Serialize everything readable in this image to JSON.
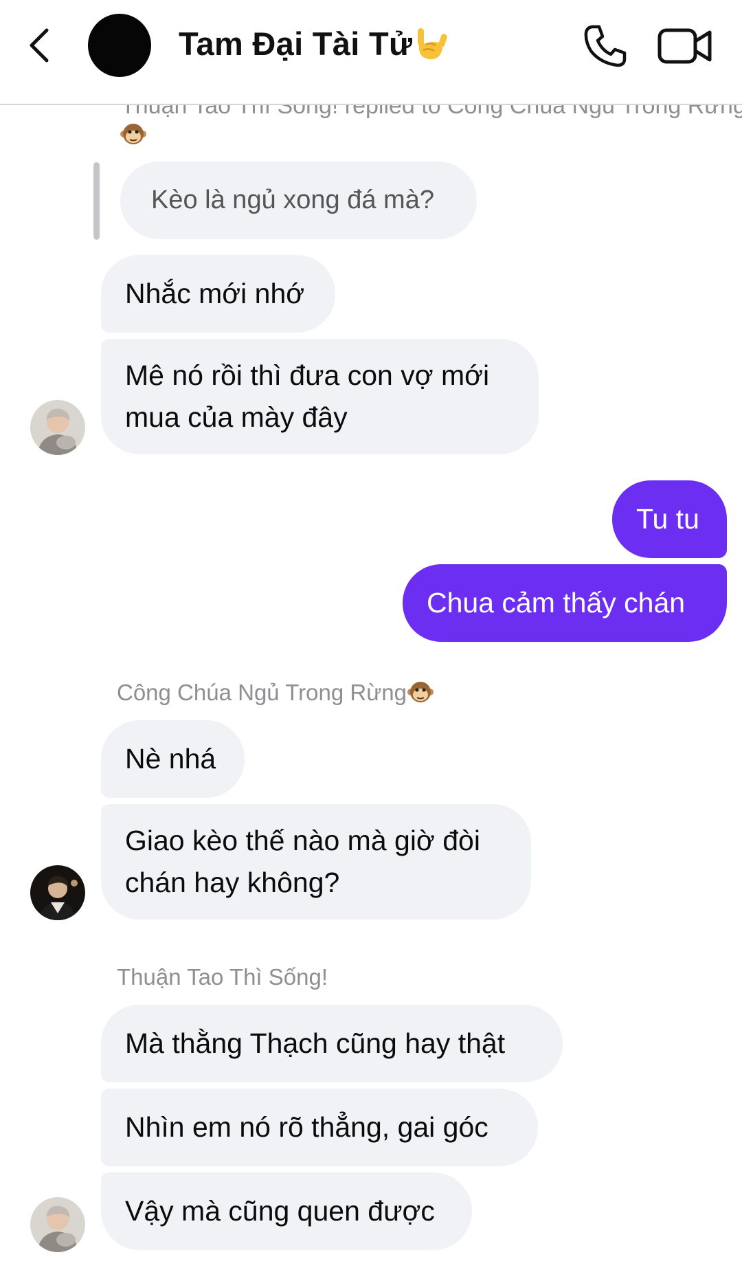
{
  "header": {
    "title": "Tam Đại Tài Tử",
    "title_emoji": "rock-on-hand-emoji",
    "back_icon": "chevron-left-icon",
    "call_icon": "phone-icon",
    "video_icon": "video-camera-icon"
  },
  "reply_context": {
    "label": "Thuận Tao Thì Sống! replied to Công Chúa Ngủ Trong Rừng",
    "label_emoji": "monkey-face-emoji",
    "quoted_text": "Kèo là ngủ xong đá mà?"
  },
  "messages": [
    {
      "text": "Nhắc mới nhớ"
    },
    {
      "text": "Mê nó rồi thì đưa con vợ mới mua của mày đây"
    },
    {
      "text": "Tu tu"
    },
    {
      "text": "Chua cảm thấy chán"
    },
    {
      "sender": "Công Chúa Ngủ Trong Rừng",
      "sender_emoji": "monkey-face-emoji"
    },
    {
      "text": "Nè nhá"
    },
    {
      "text": "Giao kèo thế nào mà giờ đòi chán hay không?"
    },
    {
      "sender": "Thuận Tao Thì Sống!"
    },
    {
      "text": "Mà thằng Thạch cũng hay thật"
    },
    {
      "text": "Nhìn em nó rõ thẳng, gai góc"
    },
    {
      "text": "Vậy mà cũng quen được"
    }
  ],
  "colors": {
    "outgoing_bubble": "#6c2ff2",
    "incoming_bubble": "#f1f2f5",
    "sender_name": "#8e8e93"
  }
}
